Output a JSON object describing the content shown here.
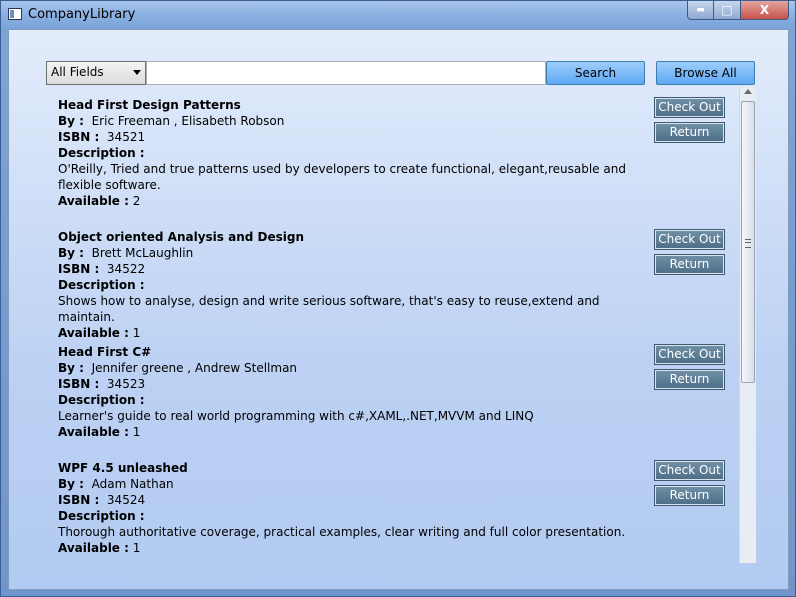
{
  "window": {
    "title": "CompanyLibrary",
    "min_label": "▬",
    "max_label": "□",
    "close_label": "X"
  },
  "search": {
    "filter_value": "All Fields",
    "query_value": "",
    "search_label": "Search",
    "browse_label": "Browse All"
  },
  "labels": {
    "by": "By :",
    "isbn": "ISBN :",
    "description": "Description :",
    "available": "Available :",
    "checkout": "Check Out",
    "return": "Return"
  },
  "books": [
    {
      "title": "Head First Design Patterns",
      "authors": "Eric Freeman , Elisabeth Robson",
      "isbn": "34521",
      "description": "O'Reilly, Tried and true patterns used by developers to create functional, elegant,reusable and flexible software.",
      "available": "2"
    },
    {
      "title": "Object oriented Analysis and Design",
      "authors": "Brett McLaughlin",
      "isbn": "34522",
      "description": "Shows how to analyse, design and write serious software, that's easy to reuse,extend and maintain.",
      "available": "1"
    },
    {
      "title": "Head First C#",
      "authors": "Jennifer greene , Andrew Stellman",
      "isbn": "34523",
      "description": "Learner's guide to real world programming with c#,XAML,.NET,MVVM and LINQ",
      "available": "1"
    },
    {
      "title": "WPF 4.5 unleashed",
      "authors": "Adam Nathan",
      "isbn": "34524",
      "description": "Thorough authoritative coverage, practical examples, clear writing and full color presentation.",
      "available": "1"
    }
  ]
}
